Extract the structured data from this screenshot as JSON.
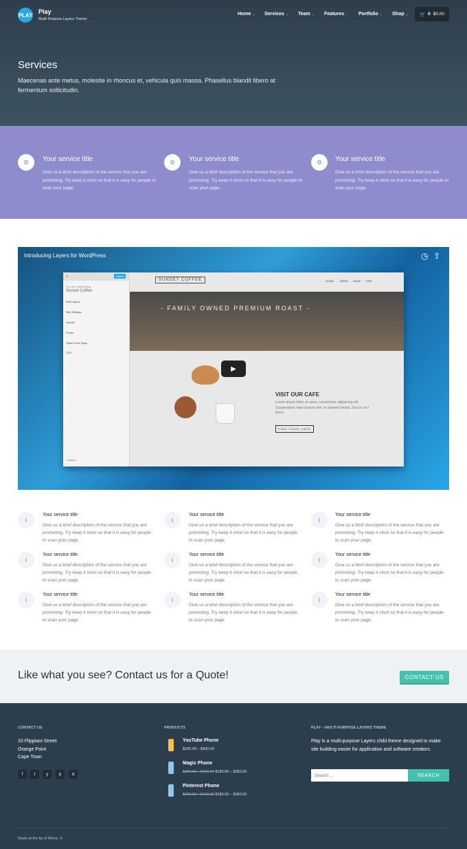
{
  "header": {
    "logo_text": "PLAY",
    "brand": "Play",
    "tagline": "Multi-Purpose Layers Theme",
    "nav": [
      "Home",
      "Services",
      "Team",
      "Features",
      "Portfolio",
      "Shop"
    ],
    "cart_count": "0",
    "cart_total": "$0.00",
    "page_title": "Services",
    "page_desc": "Maecenas ante metus, molestie in rhoncus et, vehicula quis massa. Phasellus blandit libero at fermentum sollicitudin."
  },
  "band": {
    "items": [
      {
        "title": "Your service title",
        "desc": "Give us a brief description of the service that you are promoting. Try keep it short so that it is easy for people to scan your page.",
        "icon": "gear-icon"
      },
      {
        "title": "Your service title",
        "desc": "Give us a brief description of the service that you are promoting. Try keep it short so that it is easy for people to scan your page.",
        "icon": "gear-icon"
      },
      {
        "title": "Your service title",
        "desc": "Give us a brief description of the service that you are promoting. Try keep it short so that it is easy for people to scan your page.",
        "icon": "gear-icon"
      }
    ]
  },
  "video": {
    "title": "Introducing Layers for WordPress",
    "panel_customizing": "You are customizing",
    "panel_site": "Sunset Coffee",
    "panel_save": "Saved",
    "panel_items": [
      "Edit Layout",
      "Site Settings",
      "Header",
      "Footer",
      "Static Front Page",
      "CSS"
    ],
    "panel_collapse": "Collapse",
    "site_logo": "SUNSET COFFEE",
    "site_nav": [
      "HOME",
      "BREW",
      "SHOP",
      "VISIT"
    ],
    "site_hero": "- FAMILY OWNED PREMIUM ROAST -",
    "cafe_title": "VISIT OUR CAFE",
    "cafe_desc": "Lorem ipsum dolor sit amet, consectetur adipiscing elit. Suspendisse vitae massa velit, eu laoreet massa. Sed ac orci libero.",
    "cafe_button": "FIND YOUR CAFE"
  },
  "grid": {
    "title": "Your service title",
    "desc": "Give us a brief description of the service that you are promoting. Try keep it short so that it is easy for people to scan your page.",
    "icon": "info-icon"
  },
  "cta": {
    "text": "Like what you see? Contact us for a Quote!",
    "button": "CONTACT US"
  },
  "footer": {
    "contact_heading": "CONTACT US",
    "address": [
      "10 Flippiani Street",
      "Orange Point",
      "Cape Town"
    ],
    "social": [
      "f",
      "t",
      "y",
      "p",
      "d"
    ],
    "products_heading": "PRODUCTS",
    "products": [
      {
        "name": "YouTube Phone",
        "price": "$200.00 – $400.00",
        "old": "",
        "color": "#f2c14e"
      },
      {
        "name": "Magic Phone",
        "old": "$300.00 – $400.00",
        "price": "$180.00 – $360.00",
        "color": "#8fc8ea"
      },
      {
        "name": "Pinterest Phone",
        "old": "$300.00 – $400.00",
        "price": "$180.00 – $360.00",
        "color": "#8fc8ea"
      }
    ],
    "about_heading": "PLAY – MULTI-PURPOSE LAYERS THEME",
    "about_text": "Play is a multi-purpose Layers child theme designed to make site building easier for application and software creators.",
    "search_placeholder": "Search ...",
    "search_button": "SEARCH",
    "copyright": "Made at the tip of Africa. ©"
  }
}
